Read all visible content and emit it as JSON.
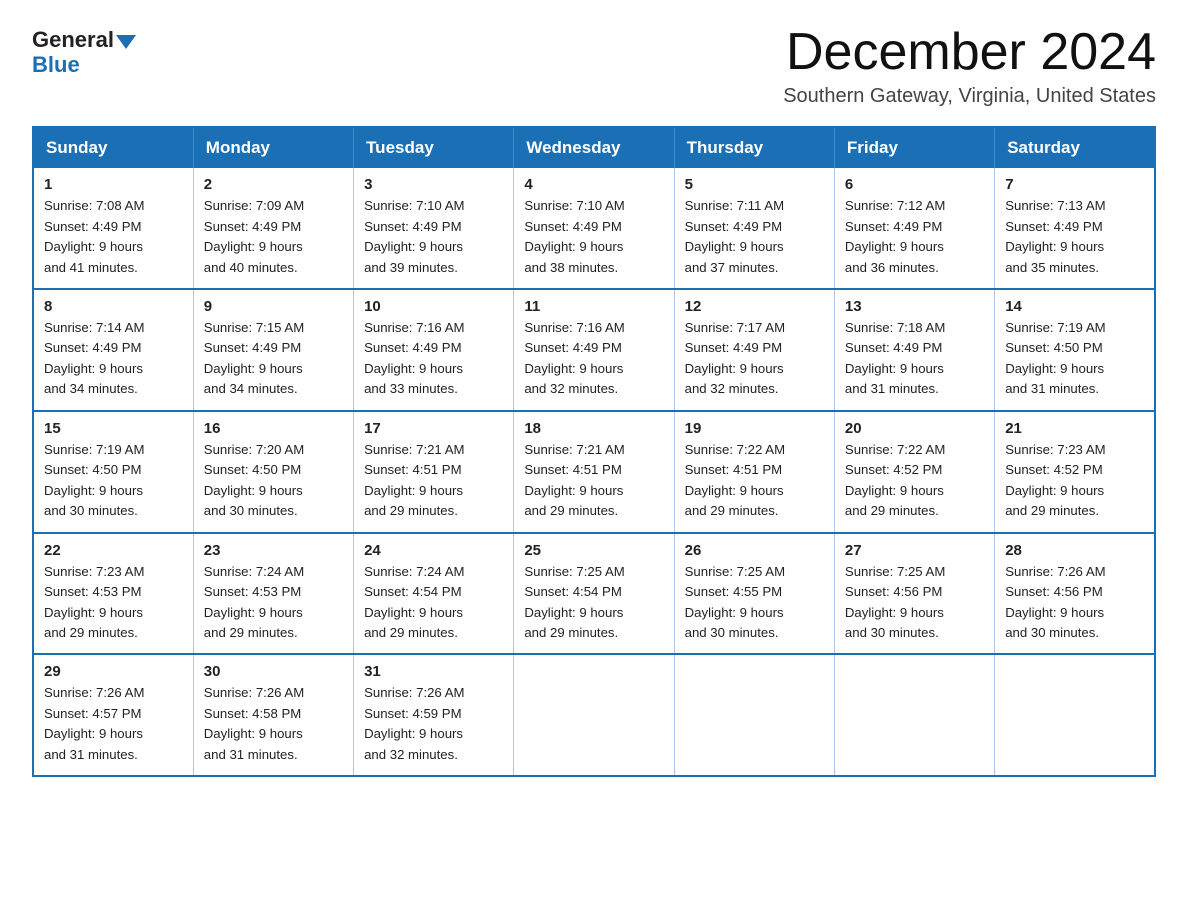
{
  "header": {
    "logo_general": "General",
    "logo_blue": "Blue",
    "month_title": "December 2024",
    "location": "Southern Gateway, Virginia, United States"
  },
  "weekdays": [
    "Sunday",
    "Monday",
    "Tuesday",
    "Wednesday",
    "Thursday",
    "Friday",
    "Saturday"
  ],
  "weeks": [
    [
      {
        "day": "1",
        "sunrise": "7:08 AM",
        "sunset": "4:49 PM",
        "daylight": "9 hours and 41 minutes."
      },
      {
        "day": "2",
        "sunrise": "7:09 AM",
        "sunset": "4:49 PM",
        "daylight": "9 hours and 40 minutes."
      },
      {
        "day": "3",
        "sunrise": "7:10 AM",
        "sunset": "4:49 PM",
        "daylight": "9 hours and 39 minutes."
      },
      {
        "day": "4",
        "sunrise": "7:10 AM",
        "sunset": "4:49 PM",
        "daylight": "9 hours and 38 minutes."
      },
      {
        "day": "5",
        "sunrise": "7:11 AM",
        "sunset": "4:49 PM",
        "daylight": "9 hours and 37 minutes."
      },
      {
        "day": "6",
        "sunrise": "7:12 AM",
        "sunset": "4:49 PM",
        "daylight": "9 hours and 36 minutes."
      },
      {
        "day": "7",
        "sunrise": "7:13 AM",
        "sunset": "4:49 PM",
        "daylight": "9 hours and 35 minutes."
      }
    ],
    [
      {
        "day": "8",
        "sunrise": "7:14 AM",
        "sunset": "4:49 PM",
        "daylight": "9 hours and 34 minutes."
      },
      {
        "day": "9",
        "sunrise": "7:15 AM",
        "sunset": "4:49 PM",
        "daylight": "9 hours and 34 minutes."
      },
      {
        "day": "10",
        "sunrise": "7:16 AM",
        "sunset": "4:49 PM",
        "daylight": "9 hours and 33 minutes."
      },
      {
        "day": "11",
        "sunrise": "7:16 AM",
        "sunset": "4:49 PM",
        "daylight": "9 hours and 32 minutes."
      },
      {
        "day": "12",
        "sunrise": "7:17 AM",
        "sunset": "4:49 PM",
        "daylight": "9 hours and 32 minutes."
      },
      {
        "day": "13",
        "sunrise": "7:18 AM",
        "sunset": "4:49 PM",
        "daylight": "9 hours and 31 minutes."
      },
      {
        "day": "14",
        "sunrise": "7:19 AM",
        "sunset": "4:50 PM",
        "daylight": "9 hours and 31 minutes."
      }
    ],
    [
      {
        "day": "15",
        "sunrise": "7:19 AM",
        "sunset": "4:50 PM",
        "daylight": "9 hours and 30 minutes."
      },
      {
        "day": "16",
        "sunrise": "7:20 AM",
        "sunset": "4:50 PM",
        "daylight": "9 hours and 30 minutes."
      },
      {
        "day": "17",
        "sunrise": "7:21 AM",
        "sunset": "4:51 PM",
        "daylight": "9 hours and 29 minutes."
      },
      {
        "day": "18",
        "sunrise": "7:21 AM",
        "sunset": "4:51 PM",
        "daylight": "9 hours and 29 minutes."
      },
      {
        "day": "19",
        "sunrise": "7:22 AM",
        "sunset": "4:51 PM",
        "daylight": "9 hours and 29 minutes."
      },
      {
        "day": "20",
        "sunrise": "7:22 AM",
        "sunset": "4:52 PM",
        "daylight": "9 hours and 29 minutes."
      },
      {
        "day": "21",
        "sunrise": "7:23 AM",
        "sunset": "4:52 PM",
        "daylight": "9 hours and 29 minutes."
      }
    ],
    [
      {
        "day": "22",
        "sunrise": "7:23 AM",
        "sunset": "4:53 PM",
        "daylight": "9 hours and 29 minutes."
      },
      {
        "day": "23",
        "sunrise": "7:24 AM",
        "sunset": "4:53 PM",
        "daylight": "9 hours and 29 minutes."
      },
      {
        "day": "24",
        "sunrise": "7:24 AM",
        "sunset": "4:54 PM",
        "daylight": "9 hours and 29 minutes."
      },
      {
        "day": "25",
        "sunrise": "7:25 AM",
        "sunset": "4:54 PM",
        "daylight": "9 hours and 29 minutes."
      },
      {
        "day": "26",
        "sunrise": "7:25 AM",
        "sunset": "4:55 PM",
        "daylight": "9 hours and 30 minutes."
      },
      {
        "day": "27",
        "sunrise": "7:25 AM",
        "sunset": "4:56 PM",
        "daylight": "9 hours and 30 minutes."
      },
      {
        "day": "28",
        "sunrise": "7:26 AM",
        "sunset": "4:56 PM",
        "daylight": "9 hours and 30 minutes."
      }
    ],
    [
      {
        "day": "29",
        "sunrise": "7:26 AM",
        "sunset": "4:57 PM",
        "daylight": "9 hours and 31 minutes."
      },
      {
        "day": "30",
        "sunrise": "7:26 AM",
        "sunset": "4:58 PM",
        "daylight": "9 hours and 31 minutes."
      },
      {
        "day": "31",
        "sunrise": "7:26 AM",
        "sunset": "4:59 PM",
        "daylight": "9 hours and 32 minutes."
      },
      null,
      null,
      null,
      null
    ]
  ],
  "labels": {
    "sunrise": "Sunrise:",
    "sunset": "Sunset:",
    "daylight": "Daylight:"
  }
}
